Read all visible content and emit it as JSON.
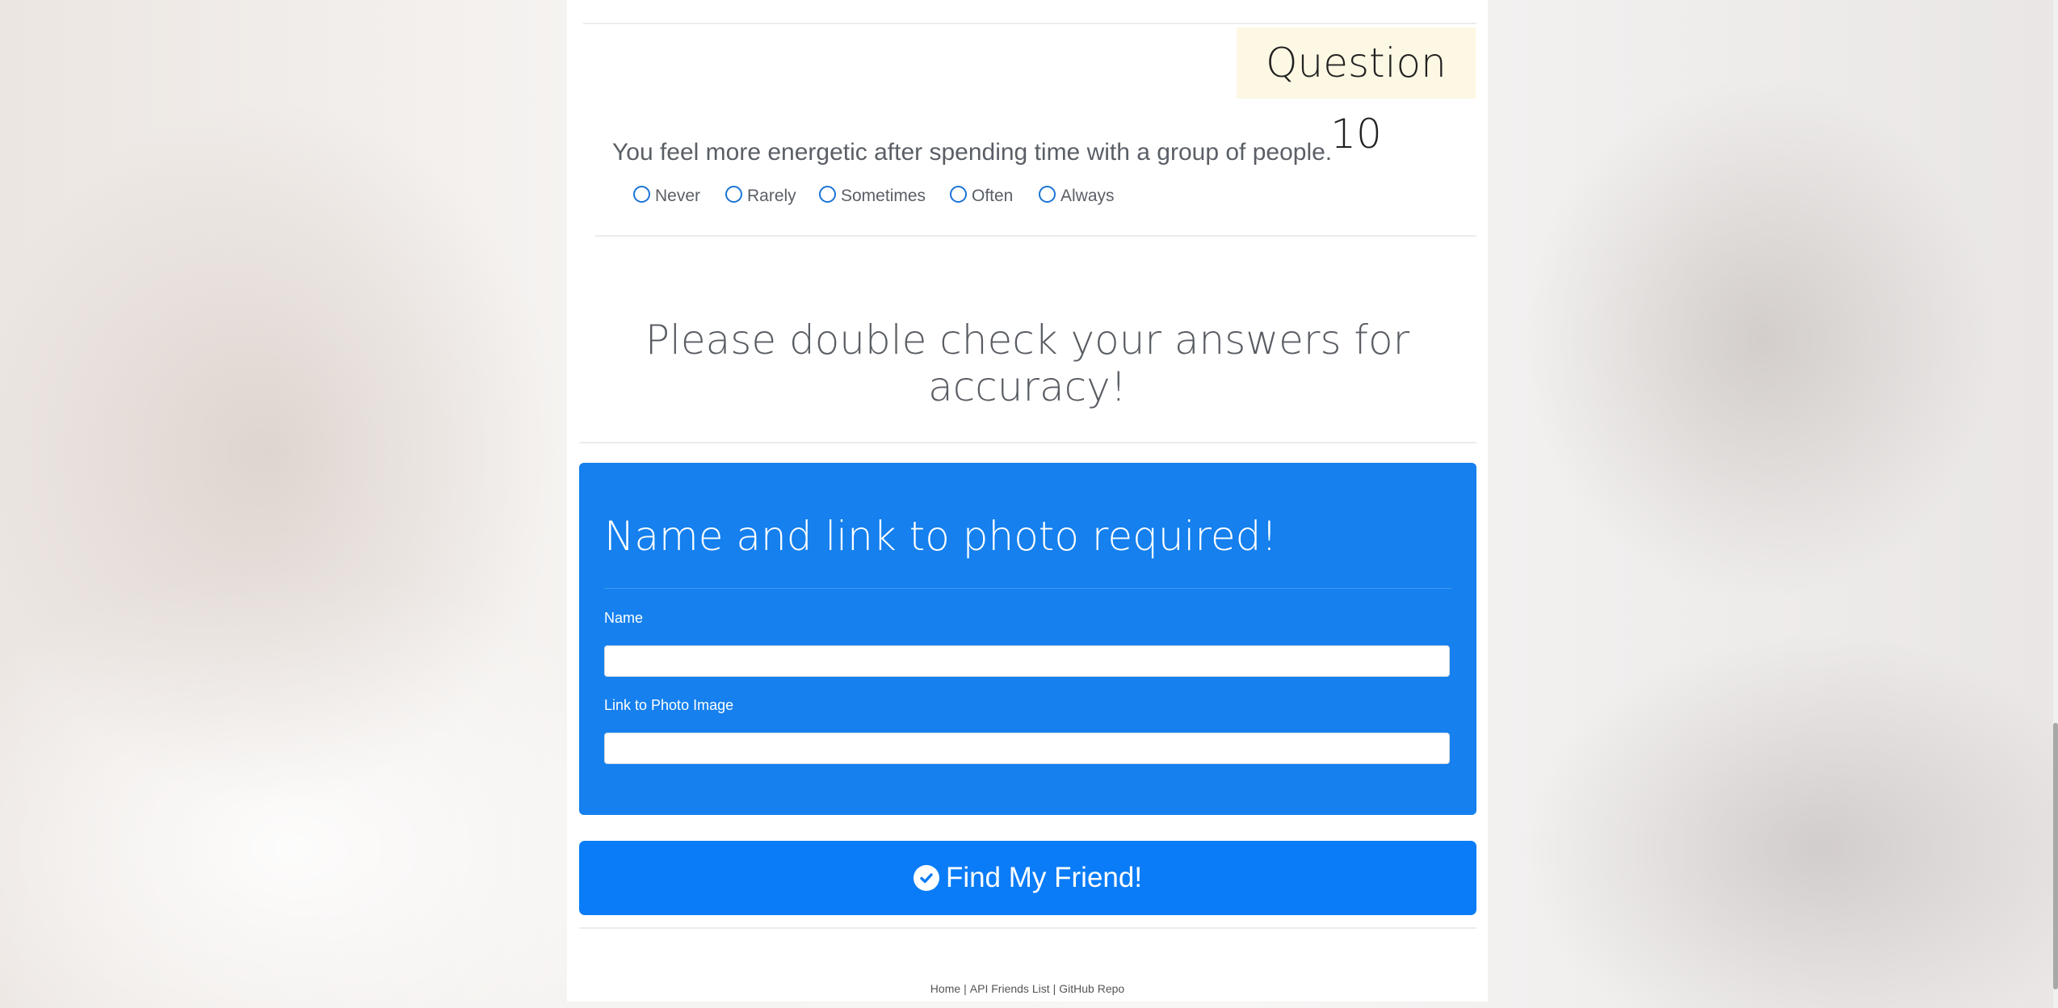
{
  "question": {
    "badge": "Question 10",
    "text": "You feel more energetic after spending time with a group of people.",
    "options": [
      "Never",
      "Rarely",
      "Sometimes",
      "Often",
      "Always"
    ]
  },
  "notice": "Please double check your answers for accuracy!",
  "form": {
    "title": "Name and link to photo required!",
    "name_label": "Name",
    "name_value": "",
    "photo_label": "Link to Photo Image",
    "photo_value": ""
  },
  "submit_label": "Find My Friend!",
  "footer": {
    "home": "Home",
    "api": "API Friends List",
    "repo": "GitHub Repo",
    "separator": "|"
  },
  "icons": {
    "submit_icon": "check-circle-icon"
  },
  "colors": {
    "form_bg": "#1580ee",
    "button_bg": "#0a7cf7",
    "badge_bg": "#fcf8e3"
  }
}
